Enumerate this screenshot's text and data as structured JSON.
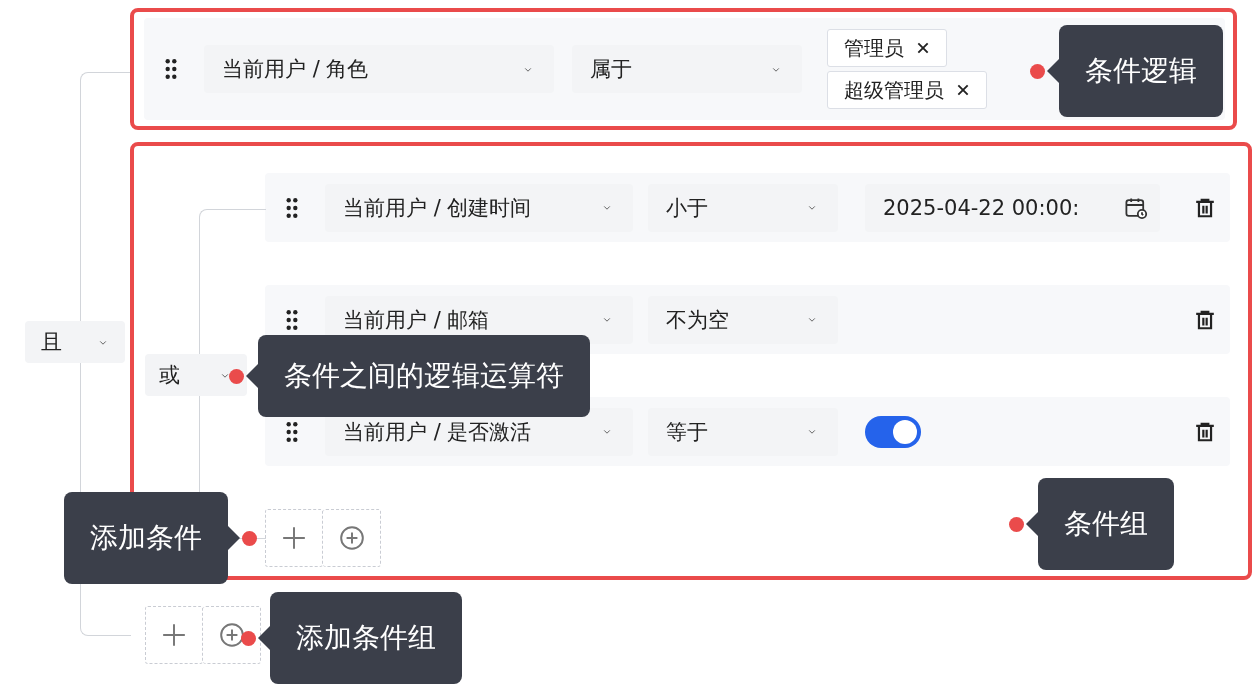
{
  "root_group": {
    "operator": "且",
    "condition": {
      "field": "当前用户 / 角色",
      "operator": "属于",
      "kind": "tags",
      "tags": [
        "管理员",
        "超级管理员"
      ]
    },
    "group": {
      "operator": "或",
      "conditions": [
        {
          "field": "当前用户 / 创建时间",
          "operator": "小于",
          "kind": "date",
          "value": "2025-04-22 00:00:"
        },
        {
          "field": "当前用户 / 邮箱",
          "operator": "不为空",
          "kind": "none"
        },
        {
          "field": "当前用户 / 是否激活",
          "operator": "等于",
          "kind": "switch",
          "on": true
        }
      ]
    }
  },
  "annotations": [
    {
      "kind": "condition",
      "text": "条件逻辑"
    },
    {
      "kind": "operator",
      "text": "条件之间的逻辑运算符"
    },
    {
      "kind": "add-condition",
      "text": "添加条件"
    },
    {
      "kind": "group",
      "text": "条件组"
    },
    {
      "kind": "add-group",
      "text": "添加条件组"
    }
  ]
}
